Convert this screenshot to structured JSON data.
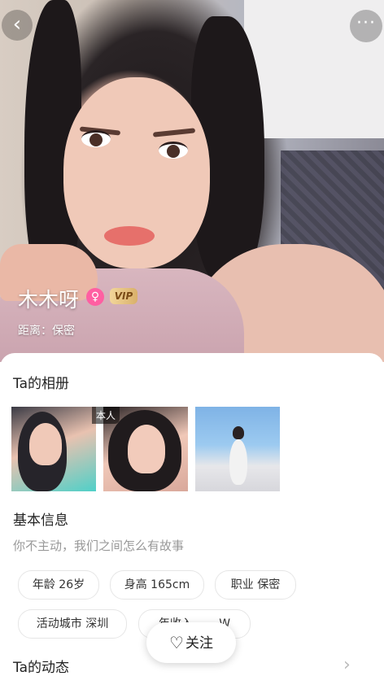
{
  "hero": {
    "name": "木木呀",
    "gender_symbol": "♀",
    "vip_label": "VIP",
    "distance": "距离：保密",
    "back_symbol": "‹",
    "more_symbol": "···"
  },
  "album": {
    "title": "Ta的相册",
    "self_tag": "本人"
  },
  "basic_info": {
    "title": "基本信息",
    "motto": "你不主动，我们之间怎么有故事",
    "chips": [
      "年龄 26岁",
      "身高 165cm",
      "职业 保密",
      "活动城市 深圳",
      "年收入 ……W"
    ]
  },
  "dynamics": {
    "title": "Ta的动态",
    "arrow": "›"
  },
  "follow_button": {
    "icon": "♡",
    "label": "关注"
  },
  "colors": {
    "gender_pink": "#ff5fa2",
    "vip_gold": "#d9b06a"
  }
}
